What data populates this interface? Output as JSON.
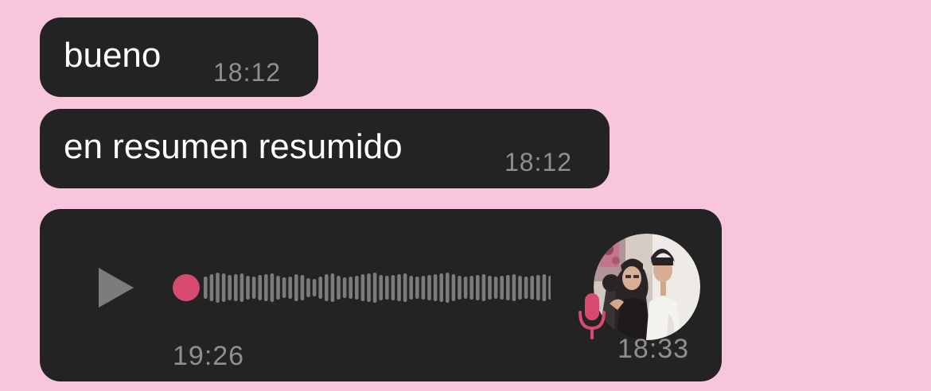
{
  "colors": {
    "background": "#f8c6dc",
    "bubble": "#232323",
    "text": "#ffffff",
    "timestamp": "#8f8f8f",
    "accent": "#d8496f",
    "waveform": "#7c7c7c"
  },
  "messages": [
    {
      "text": "bueno",
      "time": "18:12"
    },
    {
      "text": "en resumen resumido",
      "time": "18:12"
    }
  ],
  "voice_message": {
    "duration": "19:26",
    "time": "18:33",
    "progress": 0,
    "play_icon": "play-icon",
    "mic_icon": "microphone-icon",
    "avatar": "sender-avatar"
  }
}
